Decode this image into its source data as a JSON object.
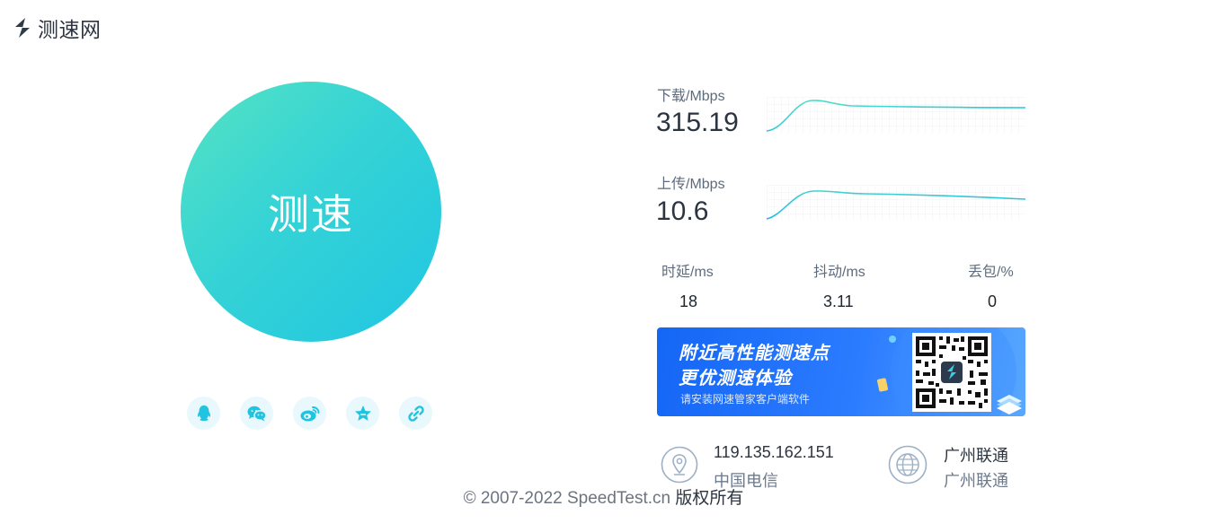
{
  "header": {
    "brand": "测速网"
  },
  "start_button": {
    "label": "测速"
  },
  "share": {
    "icons": [
      "qq-icon",
      "wechat-icon",
      "weibo-icon",
      "favorite-star-icon",
      "link-icon"
    ],
    "icon_color": "#21c4e0"
  },
  "results": {
    "download": {
      "label": "下载/Mbps",
      "value": "315.19"
    },
    "upload": {
      "label": "上传/Mbps",
      "value": "10.6"
    },
    "latency": {
      "label": "时延/ms",
      "value": "18"
    },
    "jitter": {
      "label": "抖动/ms",
      "value": "3.11"
    },
    "packet_loss": {
      "label": "丢包/%",
      "value": "0"
    }
  },
  "banner": {
    "line1": "附近高性能测速点",
    "line2": "更优测速体验",
    "subtitle": "请安装网速管家客户端软件"
  },
  "client_info": {
    "ip": "119.135.162.151",
    "isp": "中国电信"
  },
  "server_info": {
    "line1": "广州联通",
    "line2": "广州联通"
  },
  "footer": {
    "copyright": "© 2007-2022 SpeedTest.cn",
    "rights": "版权所有"
  },
  "colors": {
    "accent": "#21c4e0",
    "banner_blue": "#1466f5",
    "text_dark": "#2b3440"
  }
}
